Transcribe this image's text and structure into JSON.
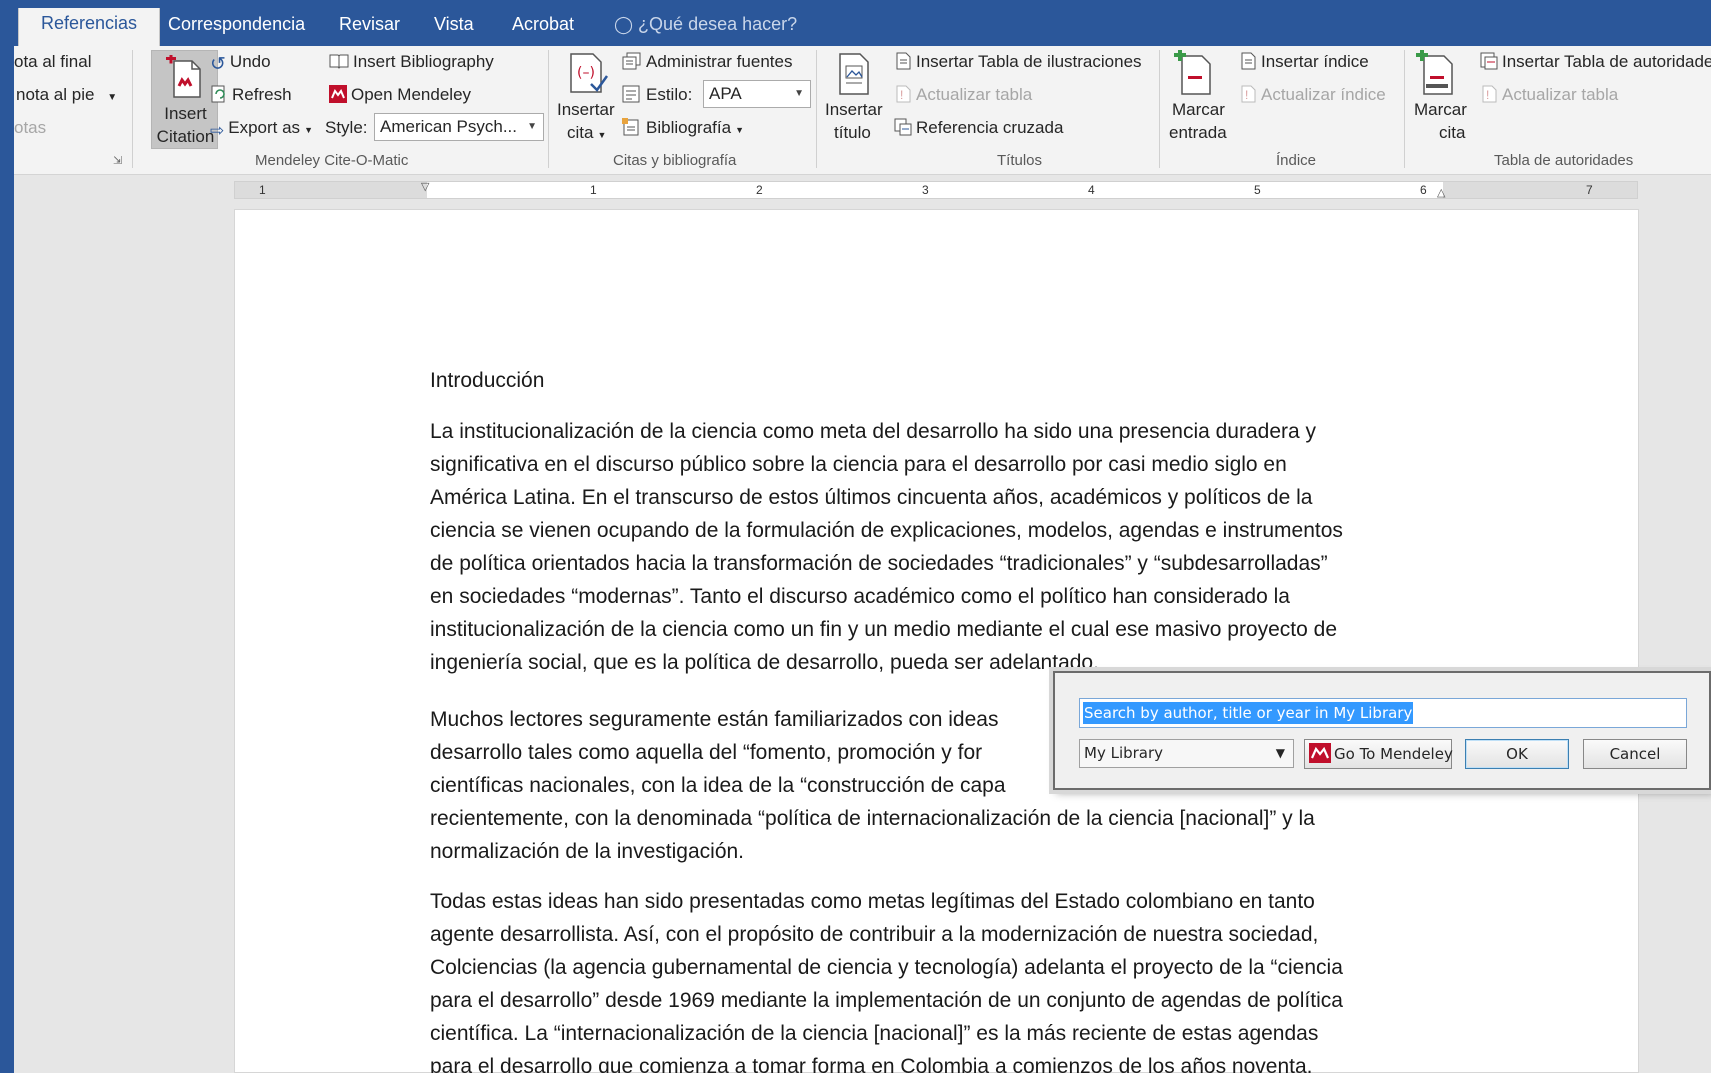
{
  "tabs": {
    "active": "Referencias",
    "items": [
      "Correspondencia",
      "Revisar",
      "Vista",
      "Acrobat"
    ],
    "tell_me": "¿Qué desea hacer?"
  },
  "ribbon": {
    "footnotes": {
      "endnote": "ota al final",
      "next_footnote": "nota al pie",
      "notes": "otas"
    },
    "mendeley": {
      "insert_citation_line1": "Insert",
      "insert_citation_line2": "Citation",
      "undo": "Undo",
      "refresh": "Refresh",
      "export_as": "Export as",
      "insert_bibliography": "Insert Bibliography",
      "open_mendeley": "Open Mendeley",
      "style_label": "Style:",
      "style_value": "American Psych...",
      "group_label": "Mendeley Cite-O-Matic"
    },
    "citations": {
      "insert_cite_line1": "Insertar",
      "insert_cite_line2": "cita",
      "manage_sources": "Administrar fuentes",
      "style_label": "Estilo:",
      "style_value": "APA",
      "bibliography": "Bibliografía",
      "group_label": "Citas y bibliografía"
    },
    "captions": {
      "insert_caption_line1": "Insertar",
      "insert_caption_line2": "título",
      "insert_table_figures": "Insertar Tabla de ilustraciones",
      "update_table": "Actualizar tabla",
      "cross_reference": "Referencia cruzada",
      "group_label": "Títulos"
    },
    "index": {
      "mark_entry_line1": "Marcar",
      "mark_entry_line2": "entrada",
      "insert_index": "Insertar índice",
      "update_index": "Actualizar índice",
      "group_label": "Índice"
    },
    "authorities": {
      "mark_citation_line1": "Marcar",
      "mark_citation_line2": "cita",
      "insert_table_authorities": "Insertar Tabla de autoridade",
      "update_table": "Actualizar tabla",
      "group_label": "Tabla de autoridades"
    }
  },
  "ruler": [
    "1",
    "1",
    "2",
    "3",
    "4",
    "5",
    "6",
    "7"
  ],
  "document": {
    "heading": "Introducción",
    "para1": [
      "La institucionalización de la ciencia como meta del desarrollo ha sido una presencia duradera y",
      "significativa en el discurso público sobre la ciencia para el desarrollo por casi medio siglo en",
      "América Latina. En el transcurso de estos últimos cincuenta años, académicos y políticos de la",
      "ciencia se vienen ocupando de la formulación de explicaciones, modelos, agendas e instrumentos",
      "de política orientados hacia la transformación de sociedades “tradicionales” y “subdesarrolladas”",
      "en sociedades “modernas”. Tanto el discurso académico como el político han considerado la",
      "institucionalización de la ciencia como un fin y un medio mediante el cual ese masivo proyecto de",
      "ingeniería social, que es la política de desarrollo, pueda ser adelantado."
    ],
    "para2": [
      "Muchos lectores seguramente están familiarizados con ideas",
      "desarrollo tales como aquella del “fomento, promoción y for",
      "científicas nacionales, con la idea de la “construcción de capa",
      "recientemente, con la denominada “política de internacionalización de la ciencia [nacional]” y la",
      "normalización de la investigación."
    ],
    "para3": [
      "Todas estas ideas han sido presentadas como metas legítimas del Estado colombiano en tanto",
      "agente desarrollista. Así, con el propósito de contribuir a la modernización de nuestra sociedad,",
      "Colciencias (la agencia gubernamental de ciencia y tecnología) adelanta el proyecto de la “ciencia",
      "para el desarrollo” desde 1969 mediante la implementación de un conjunto de agendas de política",
      "científica. La “internacionalización de la ciencia [nacional]” es la más reciente de estas agendas",
      "para el desarrollo que comienza a tomar forma en Colombia a comienzos de los años noventa."
    ]
  },
  "dialog": {
    "search_text": "Search by author, title or year in My Library",
    "library_value": "My Library",
    "go_to_mendeley": "Go To Mendeley",
    "ok": "OK",
    "cancel": "Cancel"
  },
  "colors": {
    "accent": "#2b579a",
    "mendeley_red": "#c00f2b",
    "selection": "#3399ff"
  }
}
